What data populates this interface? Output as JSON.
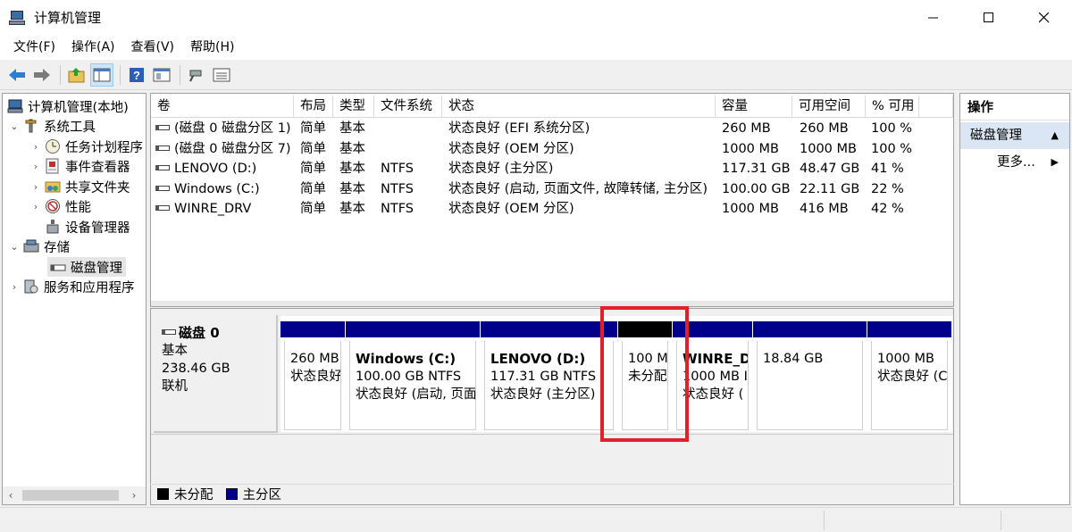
{
  "window": {
    "title": "计算机管理",
    "icons": {
      "app": "computer-management-icon",
      "minimize": "minimize-icon",
      "maximize": "maximize-icon",
      "close": "close-icon"
    }
  },
  "menu": [
    "文件(F)",
    "操作(A)",
    "查看(V)",
    "帮助(H)"
  ],
  "toolbar": [
    "back-arrow-icon",
    "forward-arrow-icon",
    "up-folder-icon",
    "show-hide-tree-icon",
    "help-icon",
    "properties-icon",
    "connect-icon",
    "list-view-icon"
  ],
  "tree": {
    "root": "计算机管理(本地)",
    "items": [
      {
        "label": "系统工具",
        "icon": "tools-icon"
      },
      {
        "label": "任务计划程序",
        "icon": "clock-icon"
      },
      {
        "label": "事件查看器",
        "icon": "event-viewer-icon"
      },
      {
        "label": "共享文件夹",
        "icon": "shared-folder-icon"
      },
      {
        "label": "性能",
        "icon": "performance-icon"
      },
      {
        "label": "设备管理器",
        "icon": "device-manager-icon"
      },
      {
        "label": "存储",
        "icon": "storage-icon"
      },
      {
        "label": "磁盘管理",
        "icon": "disk-icon"
      },
      {
        "label": "服务和应用程序",
        "icon": "services-icon"
      }
    ],
    "expand_icon": "chevron-down-icon",
    "collapse_icon": "chevron-right-icon"
  },
  "volumes": {
    "columns": [
      "卷",
      "布局",
      "类型",
      "文件系统",
      "状态",
      "容量",
      "可用空间",
      "% 可用"
    ],
    "rows": [
      [
        "(磁盘 0 磁盘分区 1)",
        "简单",
        "基本",
        "",
        "状态良好 (EFI 系统分区)",
        "260 MB",
        "260 MB",
        "100 %"
      ],
      [
        "(磁盘 0 磁盘分区 7)",
        "简单",
        "基本",
        "",
        "状态良好 (OEM 分区)",
        "1000 MB",
        "1000 MB",
        "100 %"
      ],
      [
        "LENOVO (D:)",
        "简单",
        "基本",
        "NTFS",
        "状态良好 (主分区)",
        "117.31 GB",
        "48.47 GB",
        "41 %"
      ],
      [
        "Windows (C:)",
        "简单",
        "基本",
        "NTFS",
        "状态良好 (启动, 页面文件, 故障转储, 主分区)",
        "100.00 GB",
        "22.11 GB",
        "22 %"
      ],
      [
        "WINRE_DRV",
        "简单",
        "基本",
        "NTFS",
        "状态良好 (OEM 分区)",
        "1000 MB",
        "416 MB",
        "42 %"
      ]
    ]
  },
  "disk": {
    "name": "磁盘 0",
    "type": "基本",
    "size": "238.46 GB",
    "state": "联机",
    "partitions": [
      {
        "name": "",
        "line1": "260 MB",
        "line2": "状态良好",
        "unallocated": false
      },
      {
        "name": "Windows  (C:)",
        "line1": "100.00 GB NTFS",
        "line2": "状态良好 (启动, 页面",
        "unallocated": false
      },
      {
        "name": "LENOVO  (D:)",
        "line1": "117.31 GB NTFS",
        "line2": "状态良好 (主分区)",
        "unallocated": false
      },
      {
        "name": "",
        "line1": "100 M",
        "line2": "未分配",
        "unallocated": true
      },
      {
        "name": "WINRE_D",
        "line1": "1000 MB I",
        "line2": "状态良好 (",
        "unallocated": false
      },
      {
        "name": "",
        "line1": "18.84 GB",
        "line2": "",
        "unallocated": false
      },
      {
        "name": "",
        "line1": "1000 MB",
        "line2": "状态良好 (C",
        "unallocated": false
      }
    ]
  },
  "legend": [
    {
      "label": "未分配",
      "color": "#000000"
    },
    {
      "label": "主分区",
      "color": "#00008b"
    }
  ],
  "actions": {
    "header": "操作",
    "section": "磁盘管理",
    "more": "更多..."
  },
  "colors": {
    "primary_partition": "#00008b",
    "unallocated": "#000000",
    "highlight": "#e0202a",
    "section_bg": "#dbe6f4"
  }
}
